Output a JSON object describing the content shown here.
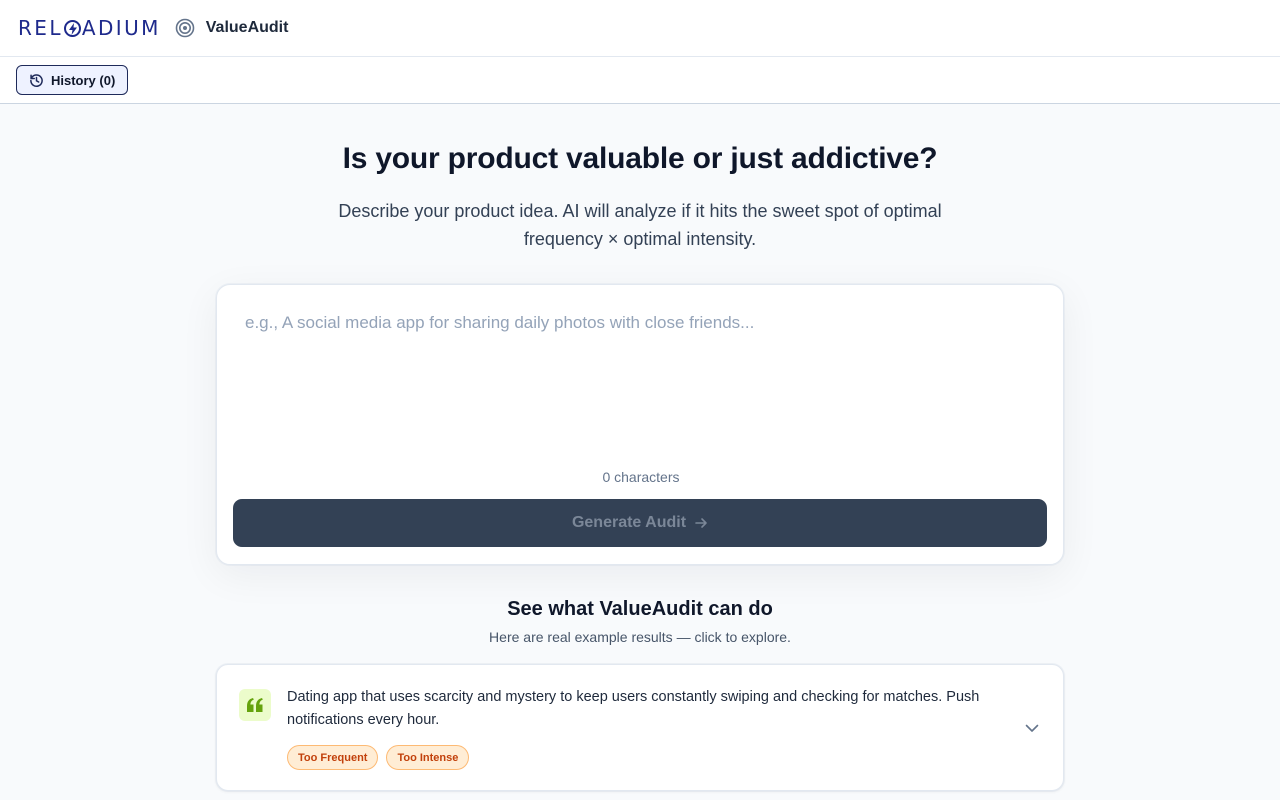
{
  "header": {
    "brand_logo_text": "RELOADIUM",
    "app_name": "ValueAudit"
  },
  "toolbar": {
    "history_label": "History (0)"
  },
  "hero": {
    "title": "Is your product valuable or just addictive?",
    "subtitle": "Describe your product idea. AI will analyze if it hits the sweet spot of optimal frequency × optimal intensity."
  },
  "composer": {
    "placeholder": "e.g., A social media app for sharing daily photos with close friends...",
    "value": "",
    "char_count": "0 characters",
    "generate_label": "Generate Audit"
  },
  "examples": {
    "title": "See what ValueAudit can do",
    "subtitle": "Here are real example results — click to explore.",
    "items": [
      {
        "text": "Dating app that uses scarcity and mystery to keep users constantly swiping and checking for matches. Push notifications every hour.",
        "tags": [
          "Too Frequent",
          "Too Intense"
        ]
      }
    ]
  },
  "icons": {
    "app": "target-icon",
    "history": "history-clock-icon",
    "generate": "arrow-right-icon",
    "quote": "quote-icon",
    "expand": "chevron-down-icon"
  },
  "colors": {
    "brand": "#1e2a8c",
    "button_bg": "#334155",
    "tag_bg": "#ffedd5",
    "tag_text": "#c2410c",
    "quote_accent": "#65a30d"
  }
}
